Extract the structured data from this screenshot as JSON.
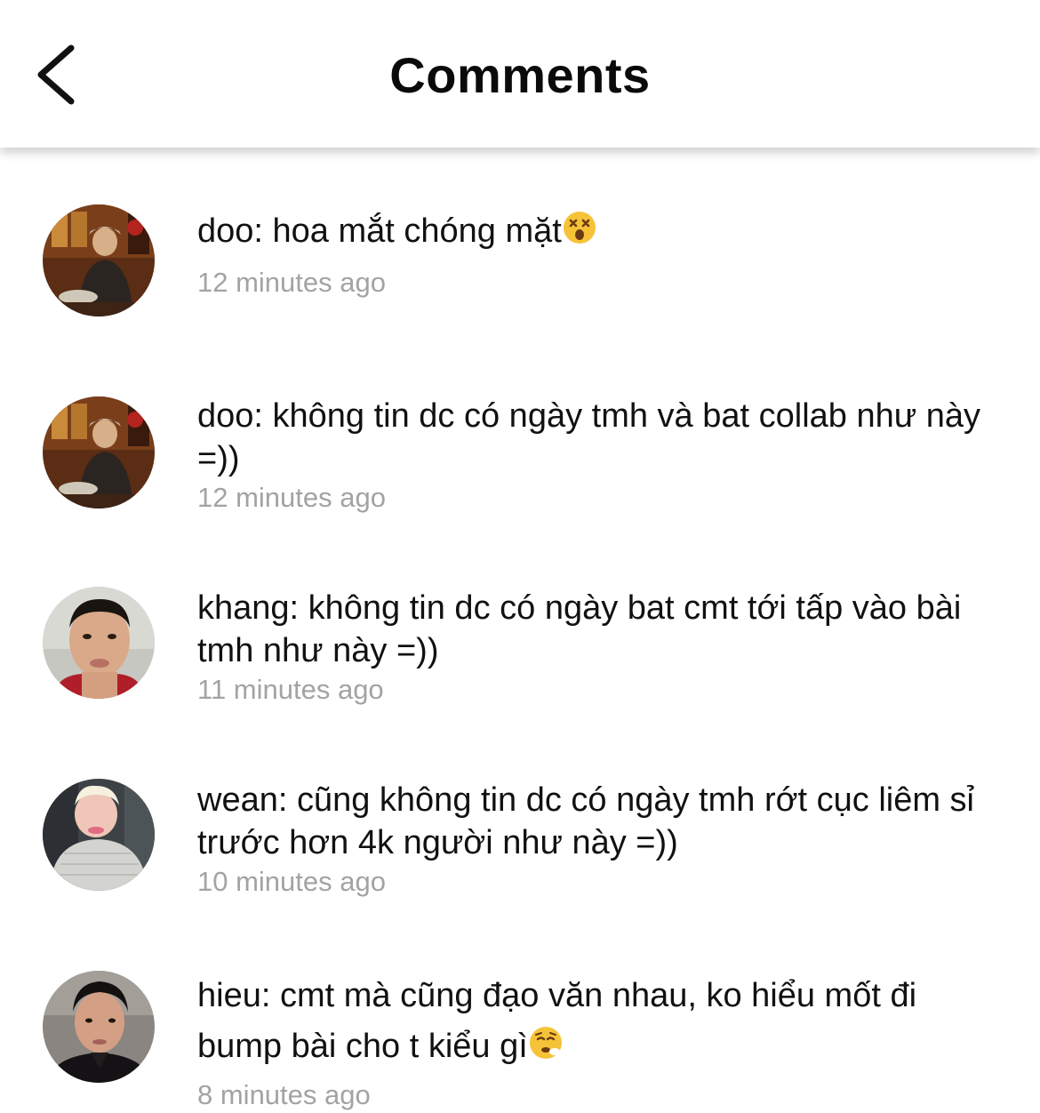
{
  "header": {
    "title": "Comments",
    "back_icon": "chevron-left-icon"
  },
  "comments": [
    {
      "author": "doo",
      "text": "doo: hoa mắt chóng mặt",
      "emoji": "dizzy-face-emoji",
      "time": "12 minutes ago"
    },
    {
      "author": "doo",
      "text": "doo: không tin dc có ngày tmh và bat collab như này =))",
      "time": "12 minutes ago"
    },
    {
      "author": "khang",
      "text": "khang: không tin dc có ngày bat cmt tới tấp vào bài tmh như này =))",
      "time": "11 minutes ago"
    },
    {
      "author": "wean",
      "text": "wean: cũng không tin dc có ngày tmh rớt cục liêm sỉ trước hơn 4k người như này =))",
      "time": "10 minutes ago"
    },
    {
      "author": "hieu",
      "text": "hieu: cmt mà cũng đạo văn nhau, ko hiểu mốt đi bump bài cho t kiểu gì",
      "emoji": "persevering-face-emoji",
      "time": "8 minutes ago"
    }
  ],
  "colors": {
    "text": "#111111",
    "timestamp": "#a3a3a3",
    "background": "#ffffff"
  }
}
